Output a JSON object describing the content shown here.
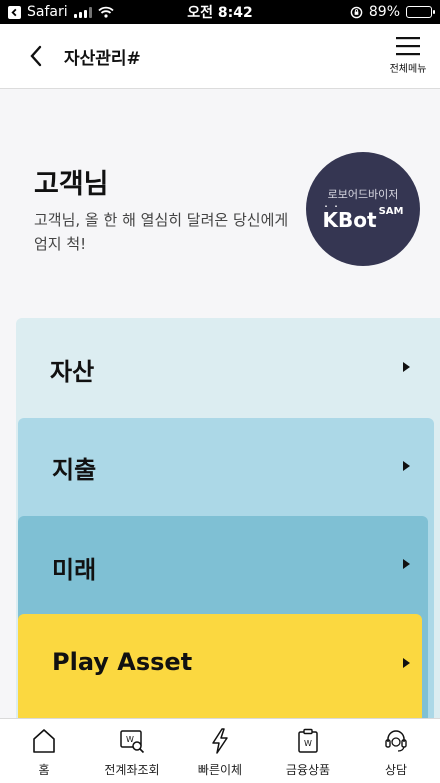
{
  "status_bar": {
    "app": "Safari",
    "time": "오전 8:42",
    "battery": "89%",
    "battery_level": 0.89
  },
  "header": {
    "title": "자산관리#",
    "menu_label": "전체메뉴"
  },
  "greeting": {
    "name": "고객님",
    "message": "고객님, 올 한 해 열심히 달려온 당신에게 엄지 척!"
  },
  "kbot": {
    "subtitle": "로보어드바이저",
    "logo_main": "KBot",
    "logo_sup": "SAM"
  },
  "cards": [
    {
      "label": "자산",
      "color": "#dcedf1"
    },
    {
      "label": "지출",
      "color": "#acd8e7"
    },
    {
      "label": "미래",
      "color": "#7fc0d4"
    },
    {
      "label": "Play Asset",
      "color": "#fbd840"
    }
  ],
  "bottom_nav": [
    {
      "label": "홈",
      "icon": "home-icon"
    },
    {
      "label": "전계좌조회",
      "icon": "account-search-icon"
    },
    {
      "label": "빠른이체",
      "icon": "lightning-icon"
    },
    {
      "label": "금융상품",
      "icon": "product-icon"
    },
    {
      "label": "상담",
      "icon": "headset-icon"
    }
  ]
}
